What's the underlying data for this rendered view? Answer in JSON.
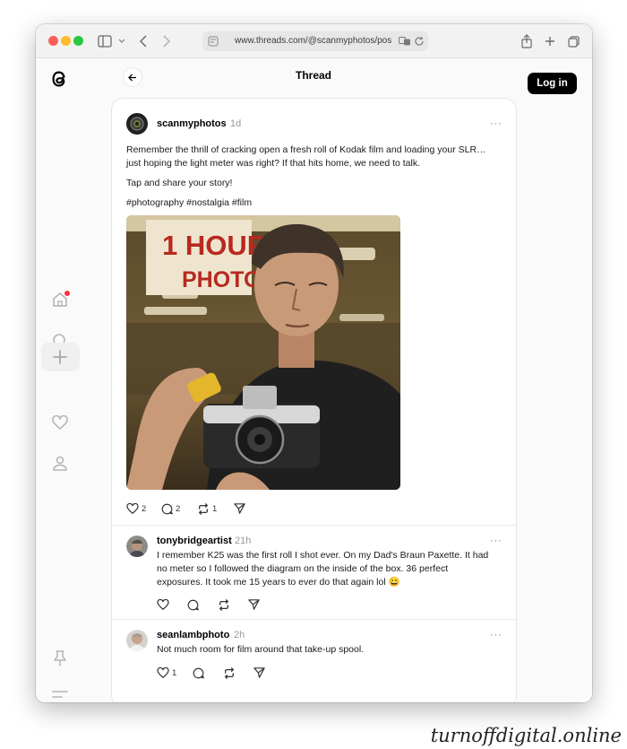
{
  "browser": {
    "url": "www.threads.com/@scanmyphotos/pos"
  },
  "header": {
    "title": "Thread",
    "login_label": "Log in"
  },
  "post": {
    "username": "scanmyphotos",
    "time": "1d",
    "more": "···",
    "line1": "Remember the thrill of cracking open a fresh roll of Kodak film and loading your SLR…",
    "line2": "just hoping the light meter was right? If that hits home, we need to talk.",
    "line3": "Tap and share your story!",
    "hashtags": "#photography #nostalgia #film",
    "photo_sign_line1": "1 HOUR",
    "photo_sign_line2": "PHOTO",
    "likes": "2",
    "comments": "2",
    "reposts": "1"
  },
  "replies": [
    {
      "username": "tonybridgeartist",
      "time": "21h",
      "more": "···",
      "line1": "I remember K25 was the first roll I shot ever. On my Dad's Braun Paxette. It had",
      "line2": "no meter so I followed the diagram on the inside of the box. 36 perfect",
      "line3": "exposures. It took me 15 years to ever do that again lol 😀"
    },
    {
      "username": "seanlambphoto",
      "time": "2h",
      "more": "···",
      "line1": "Not much room for film around that take-up spool.",
      "likes": "1"
    }
  ],
  "watermark": "turnoffdigital.online",
  "colors": {
    "login_bg": "#000000",
    "notification_dot": "#ff3040",
    "traffic_red": "#fe5f57",
    "traffic_yellow": "#febc2e",
    "traffic_green": "#28c840"
  }
}
